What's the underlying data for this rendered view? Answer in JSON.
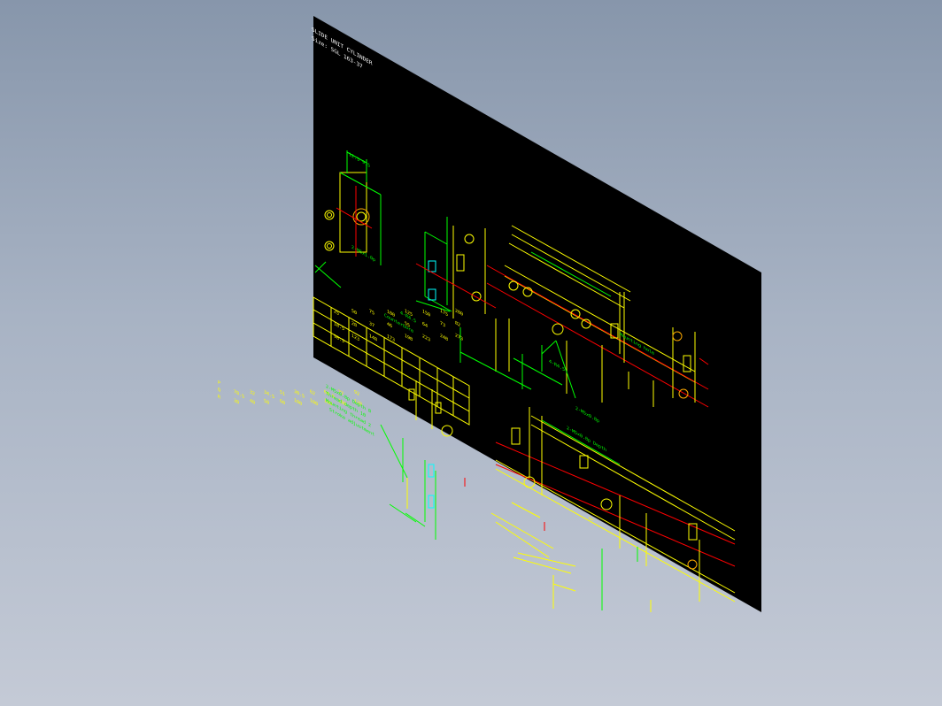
{
  "sheet": {
    "title_line1": "SLIDE UNIT CYLINDER",
    "title_line2": "Size: SGL 163-37"
  },
  "drawing_labels": {
    "dim_top": "12.5  9.5",
    "note_hole": "2-M6x1.0p",
    "note_slot": "4-R4.5",
    "note_thread": "2-M5x0.8p",
    "note_thread2": "2-M5x0.8p Depth",
    "note_spot": "4-R4.5",
    "note_counter": "Counterbore",
    "note_mount": "Mounting hole"
  },
  "table": {
    "rows": [
      [
        "",
        "25",
        "50",
        "75",
        "100",
        "125",
        "150",
        "175",
        "200"
      ],
      [
        "",
        "18.5",
        "28",
        "37",
        "46",
        "55",
        "64",
        "73",
        "82"
      ],
      [
        "",
        "98.5",
        "123",
        "148",
        "173",
        "198",
        "223",
        "248",
        "273"
      ]
    ]
  },
  "left_table": {
    "labels": [
      "P",
      "Q",
      "R"
    ],
    "row1": [
      "78.5",
      "32",
      "34.5",
      "51",
      "30.5",
      "62",
      "64.5",
      "77",
      "92"
    ],
    "row2": [
      "30",
      "40",
      "50",
      "60",
      "100",
      "100",
      "100",
      "100",
      "120"
    ]
  },
  "green_notes": [
    "2-M5x0.8p Depth 8",
    "Thread depth 10",
    "Mounting thread 2",
    "Stroke adjustment"
  ],
  "colors": {
    "background_top": "#8796ab",
    "background_bottom": "#c4cad6",
    "sheet": "#000000",
    "yellow": "#ffff00",
    "green": "#00ff00",
    "red": "#ff0000",
    "cyan": "#00ffff",
    "white": "#ffffff",
    "orange": "#ffaa00"
  }
}
